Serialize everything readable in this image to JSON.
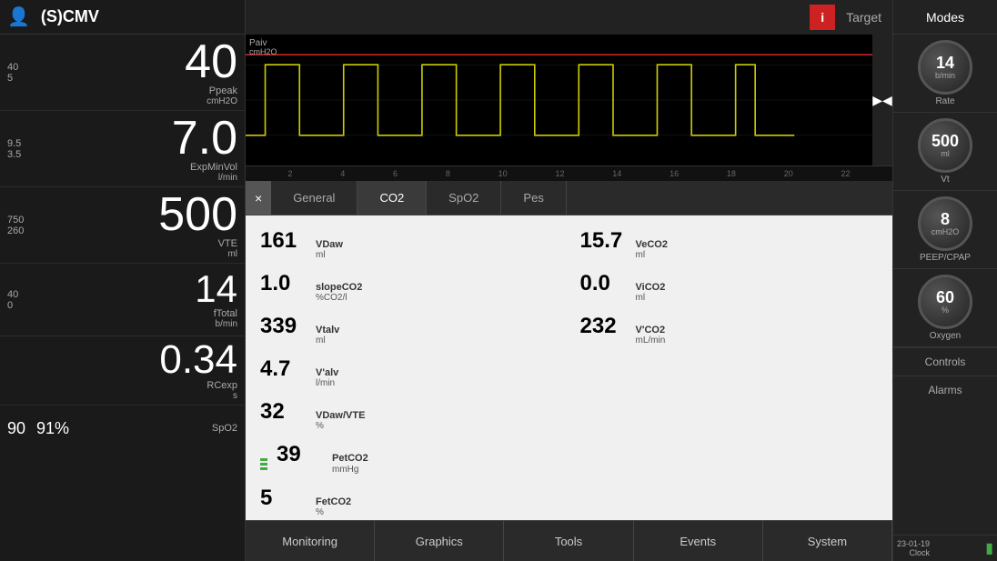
{
  "header": {
    "mode": "(S)CMV",
    "info_label": "i",
    "target_label": "Target"
  },
  "left_panel": {
    "metrics": [
      {
        "limit_high": "40",
        "limit_low": "5",
        "value": "40",
        "label": "Ppeak",
        "unit": "cmH2O",
        "size": "large"
      },
      {
        "limit_high": "9.5",
        "limit_low": "3.5",
        "value": "7.0",
        "label": "ExpMinVol",
        "unit": "l/min",
        "size": "large"
      },
      {
        "limit_high": "750",
        "limit_low": "260",
        "value": "500",
        "label": "VTE",
        "unit": "ml",
        "size": "large"
      },
      {
        "limit_high": "40",
        "limit_low": "0",
        "value": "14",
        "label": "fTotal",
        "unit": "b/min",
        "size": "medium"
      }
    ],
    "rcexp": {
      "value": "0.34",
      "label": "RCexp",
      "unit": "s"
    },
    "spo2": {
      "val1": "90",
      "val2": "91%",
      "label": "SpO2"
    }
  },
  "waveform": {
    "label": "Paiv",
    "unit": "cmH2O",
    "y_max": "40",
    "y_mid": "25",
    "y_zero": "0",
    "time_ticks": [
      "2",
      "4",
      "6",
      "8",
      "10",
      "12",
      "14",
      "16",
      "18",
      "20",
      "22"
    ]
  },
  "tabs": {
    "close_label": "×",
    "items": [
      {
        "label": "General",
        "active": false
      },
      {
        "label": "CO2",
        "active": true
      },
      {
        "label": "SpO2",
        "active": false
      },
      {
        "label": "Pes",
        "active": false
      }
    ]
  },
  "co2_data": {
    "items": [
      {
        "value": "161",
        "name": "VDaw",
        "unit": "ml"
      },
      {
        "value": "15.7",
        "name": "VeCO2",
        "unit": "ml"
      },
      {
        "value": "1.0",
        "name": "slopeCO2",
        "unit": "%CO2/l"
      },
      {
        "value": "0.0",
        "name": "ViCO2",
        "unit": "ml"
      },
      {
        "value": "339",
        "name": "Vtalv",
        "unit": "ml"
      },
      {
        "value": "232",
        "name": "V'CO2",
        "unit": "mL/min"
      },
      {
        "value": "4.7",
        "name": "V'alv",
        "unit": "l/min"
      },
      {
        "value": "32",
        "name": "VDaw/VTE",
        "unit": "%"
      },
      {
        "value": "39",
        "name": "PetCO2",
        "unit": "mmHg",
        "highlight": true
      },
      {
        "value": "5",
        "name": "FetCO2",
        "unit": "%"
      }
    ]
  },
  "bottom_nav": {
    "items": [
      {
        "label": "Monitoring",
        "active": false
      },
      {
        "label": "Graphics",
        "active": false
      },
      {
        "label": "Tools",
        "active": false
      },
      {
        "label": "Events",
        "active": false
      },
      {
        "label": "System",
        "active": false
      }
    ]
  },
  "right_panel": {
    "modes_label": "Modes",
    "knobs": [
      {
        "value": "14",
        "unit": "b/min",
        "label": "Rate"
      },
      {
        "value": "500",
        "unit": "ml",
        "label": "Vt"
      },
      {
        "value": "8",
        "unit": "cmH2O",
        "label": "PEEP/CPAP"
      },
      {
        "value": "60",
        "unit": "%",
        "label": "Oxygen"
      }
    ],
    "controls_label": "Controls",
    "alarms_label": "Alarms",
    "date": "23-01-19",
    "clock_label": "Clock"
  }
}
